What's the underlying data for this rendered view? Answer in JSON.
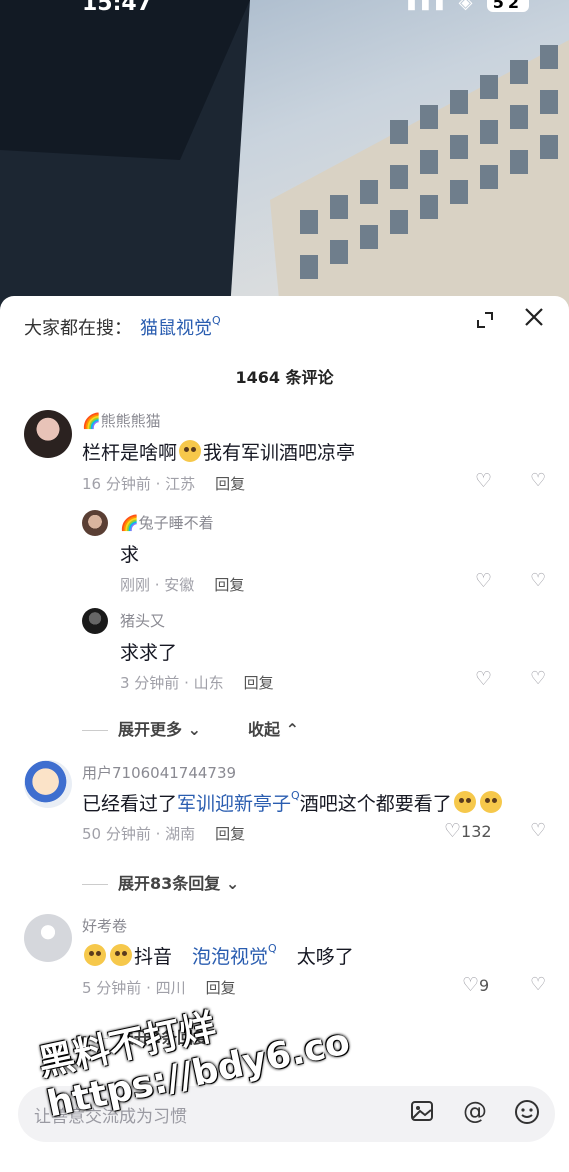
{
  "status": {
    "time": "15:47",
    "battery": "52"
  },
  "search": {
    "prefix": "大家都在搜：",
    "keyword": "猫鼠视觉"
  },
  "comment_count": "1464 条评论",
  "comments": [
    {
      "name": "🌈熊熊熊猫",
      "text": "栏杆是啥啊",
      "text2": "我有军训酒吧凉亭",
      "meta": "16 分钟前 · 江苏",
      "reply": "回复"
    },
    {
      "name": "🌈兔子睡不着",
      "text": "求",
      "meta": "刚刚 · 安徽",
      "reply": "回复"
    },
    {
      "name": "猪头又",
      "text": "求求了",
      "meta": "3 分钟前 · 山东",
      "reply": "回复"
    },
    {
      "name": "用户7106041744739",
      "text_a": "已经看过了",
      "link": "军训迎新亭子",
      "text_b": "酒吧这个都要看了",
      "meta": "50 分钟前 · 湖南",
      "reply": "回复",
      "likes": "132"
    },
    {
      "name": "好考卷",
      "text_a": "抖音",
      "link": "泡泡视觉",
      "text_b": "太哆了",
      "meta": "5 分钟前 · 四川",
      "reply": "回复",
      "likes": "9"
    }
  ],
  "expand_more": "展开更多",
  "collapse": "收起",
  "expand_83": "展开83条回复",
  "expand_partial": "展开2条回复",
  "input_placeholder": "让善意交流成为习惯",
  "watermark": {
    "line1": "黑料不打烊",
    "line2": "https://bdy6.co"
  },
  "icons": {
    "expand": "expand-icon",
    "close": "close-icon",
    "like": "heart-icon",
    "dislike": "broken-heart-icon",
    "image": "image-icon",
    "mention": "at-icon",
    "emoji": "emoji-icon"
  }
}
